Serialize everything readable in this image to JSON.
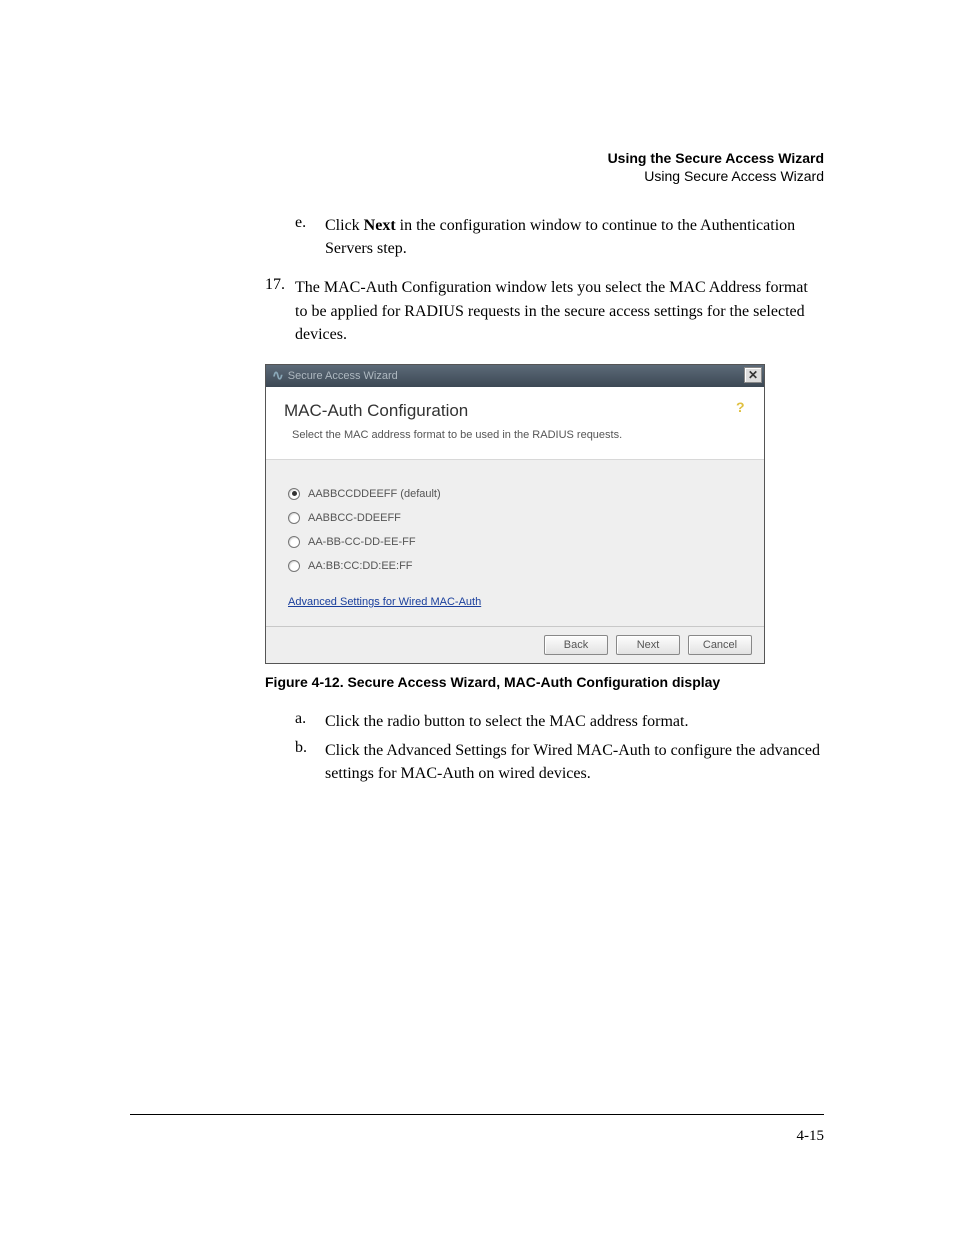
{
  "header": {
    "title": "Using the Secure Access Wizard",
    "subtitle": "Using Secure Access Wizard"
  },
  "step_e": {
    "letter": "e.",
    "pre": "Click ",
    "bold": "Next",
    "post": " in the configuration window to continue to the Authentication Servers step."
  },
  "step_17": {
    "num": "17.",
    "text": "The MAC-Auth Configuration window lets you select the MAC Address format to be applied for RADIUS requests in the secure access settings for the selected devices."
  },
  "wizard": {
    "title": "Secure Access Wizard",
    "close": "✕",
    "heading": "MAC-Auth Configuration",
    "description": "Select the MAC address format to be used in the RADIUS requests.",
    "help": "?",
    "options": [
      {
        "label": "AABBCCDDEEFF (default)",
        "selected": true
      },
      {
        "label": "AABBCC-DDEEFF",
        "selected": false
      },
      {
        "label": "AA-BB-CC-DD-EE-FF",
        "selected": false
      },
      {
        "label": "AA:BB:CC:DD:EE:FF",
        "selected": false
      }
    ],
    "advanced_link": "Advanced Settings for Wired MAC-Auth",
    "buttons": {
      "back": "Back",
      "next": "Next",
      "cancel": "Cancel"
    }
  },
  "caption": "Figure 4-12. Secure Access Wizard, MAC-Auth Configuration display",
  "sub_a": {
    "letter": "a.",
    "text": "Click the radio button to select the MAC address format."
  },
  "sub_b": {
    "letter": "b.",
    "text": "Click the Advanced Settings for Wired MAC-Auth to configure the advanced settings for MAC-Auth on wired devices."
  },
  "page_number": "4-15"
}
